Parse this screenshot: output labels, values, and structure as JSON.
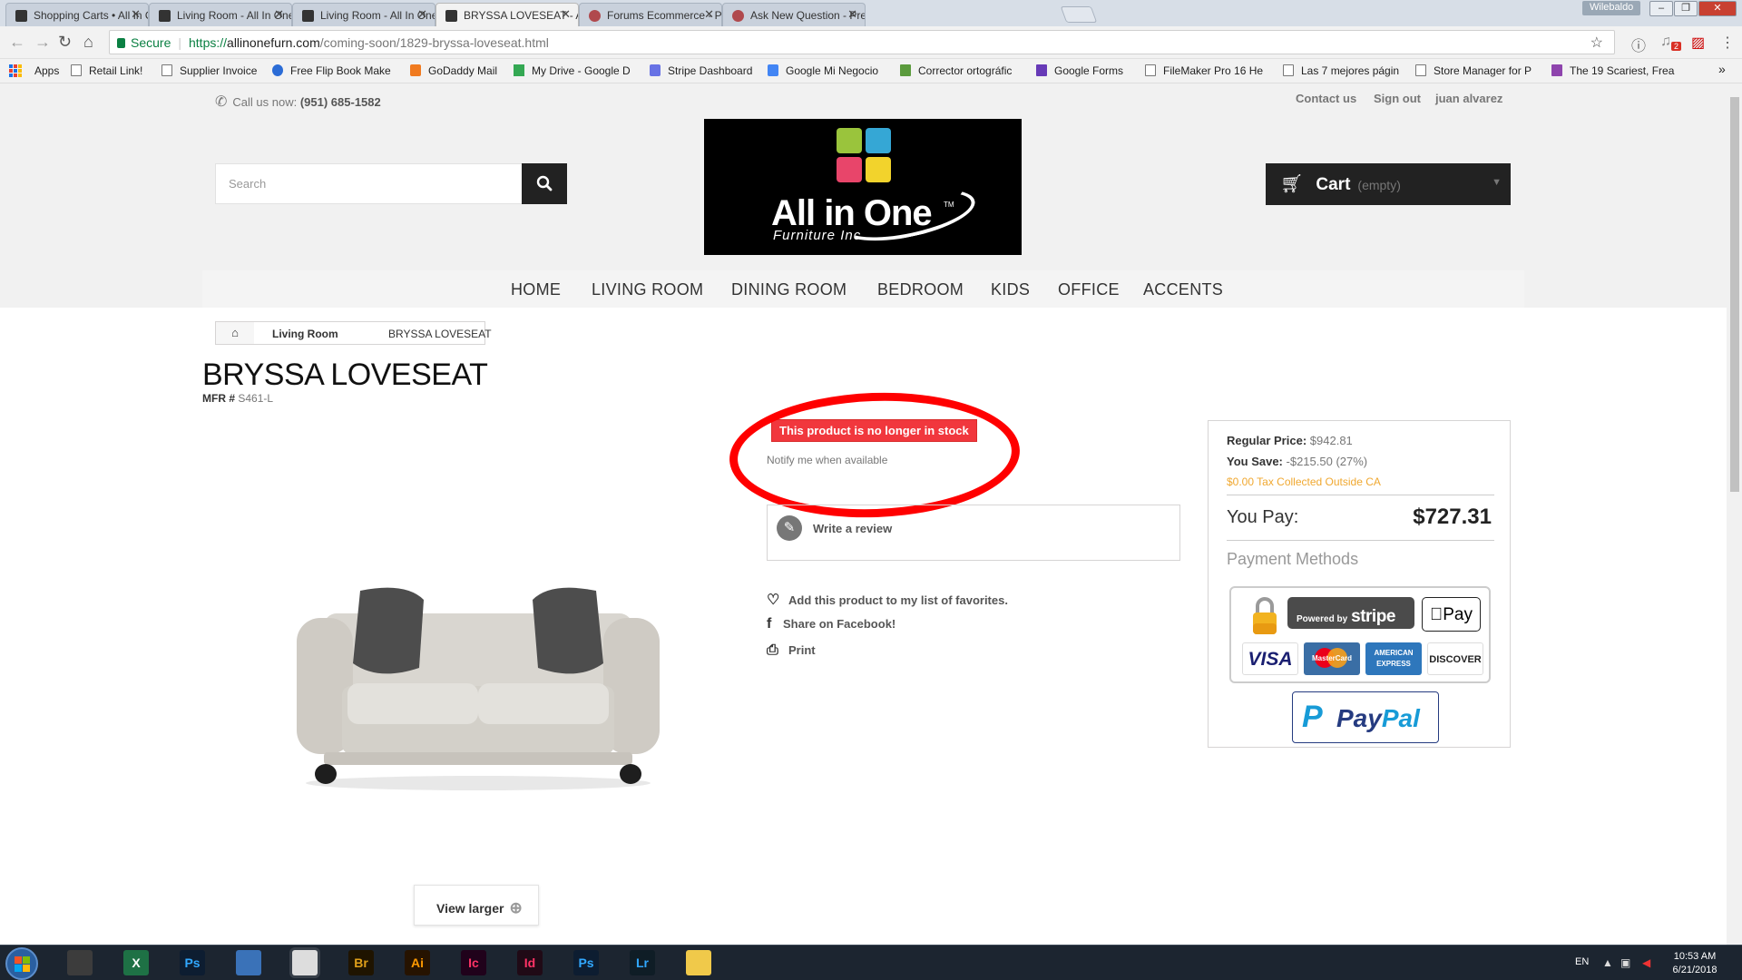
{
  "browser": {
    "tabs": [
      {
        "title": "Shopping Carts • All In O",
        "active": false,
        "icon": "site-icon"
      },
      {
        "title": "Living Room - All In One",
        "active": false,
        "icon": "site-icon"
      },
      {
        "title": "Living Room - All In One",
        "active": false,
        "icon": "site-icon"
      },
      {
        "title": "BRYSSA LOVESEAT - All I",
        "active": true,
        "icon": "site-icon"
      },
      {
        "title": "Forums Ecommerce - Pre",
        "active": false,
        "icon": "forum-icon"
      },
      {
        "title": "Ask New Question - Pres",
        "active": false,
        "icon": "forum-icon"
      }
    ],
    "profile_name": "Wilebaldo",
    "secure_label": "Secure",
    "url": {
      "scheme": "https://",
      "host": "allinonefurn.com",
      "path": "/coming-soon/1829-bryssa-loveseat.html"
    },
    "extension_badge": "2",
    "bookmarks": [
      {
        "label": "Apps"
      },
      {
        "label": "Retail Link!"
      },
      {
        "label": "Supplier Invoice"
      },
      {
        "label": "Free Flip Book Make"
      },
      {
        "label": "GoDaddy Mail"
      },
      {
        "label": "My Drive - Google D"
      },
      {
        "label": "Stripe Dashboard"
      },
      {
        "label": "Google Mi Negocio"
      },
      {
        "label": "Corrector ortográfic"
      },
      {
        "label": "Google Forms"
      },
      {
        "label": "FileMaker Pro 16 He"
      },
      {
        "label": "Las 7 mejores págin"
      },
      {
        "label": "Store Manager for P"
      },
      {
        "label": "The 19 Scariest, Frea"
      }
    ],
    "bookmarks_overflow": "»"
  },
  "header": {
    "call_label": "Call us now:",
    "phone": "(951) 685-1582",
    "top_links": [
      "Contact us",
      "Sign out",
      "juan alvarez"
    ],
    "search_placeholder": "Search",
    "logo": {
      "title": "All in One",
      "subtitle": "Furniture Inc.",
      "tm": "TM"
    },
    "cart": {
      "label": "Cart",
      "status": "(empty)"
    }
  },
  "nav": {
    "items": [
      "HOME",
      "LIVING ROOM",
      "DINING ROOM",
      "BEDROOM",
      "KIDS",
      "OFFICE",
      "ACCENTS"
    ]
  },
  "breadcrumb": {
    "category": "Living Room",
    "current": "BRYSSA LOVESEAT"
  },
  "product": {
    "title": "BRYSSA LOVESEAT",
    "mfr_label": "MFR #",
    "mfr_value": "S461-L",
    "view_larger": "View larger",
    "stock_status": "This product is no longer in stock",
    "notify": "Notify me when available",
    "write_review": "Write a review",
    "actions": [
      {
        "label": "Add this product to my list of favorites.",
        "icon": "heart-icon"
      },
      {
        "label": "Share on Facebook!",
        "icon": "facebook-icon"
      },
      {
        "label": "Print",
        "icon": "print-icon"
      }
    ]
  },
  "pricing": {
    "regular_label": "Regular Price:",
    "regular_value": "$942.81",
    "save_label": "You Save:",
    "save_value": "-$215.50 (27%)",
    "tax_note": "$0.00 Tax Collected Outside CA",
    "pay_label": "You Pay:",
    "pay_value": "$727.31",
    "payment_methods_title": "Payment Methods",
    "stripe_powered": "Powered by",
    "stripe_brand": "stripe",
    "apple_pay": "Pay",
    "cards": [
      "VISA",
      "MasterCard",
      "AMERICAN EXPRESS",
      "DISCOVER"
    ],
    "paypal": {
      "pay": "Pay",
      "pal": "Pal"
    }
  },
  "taskbar": {
    "apps": [
      {
        "label": "",
        "name": "task-manager-icon",
        "color": "#3c3c3c"
      },
      {
        "label": "X",
        "name": "excel-icon",
        "color": "#1e7145"
      },
      {
        "label": "Ps",
        "name": "photoshop-icon",
        "color": "#0d1d31"
      },
      {
        "label": "",
        "name": "windows-app-icon",
        "color": "#3a72b8"
      },
      {
        "label": "",
        "name": "chrome-icon",
        "color": "#dddddd"
      },
      {
        "label": "Br",
        "name": "bridge-icon",
        "color": "#1f1400"
      },
      {
        "label": "Ai",
        "name": "illustrator-icon",
        "color": "#261300"
      },
      {
        "label": "Ic",
        "name": "incopy-icon",
        "color": "#20021b"
      },
      {
        "label": "Id",
        "name": "indesign-icon",
        "color": "#200a16"
      },
      {
        "label": "Ps",
        "name": "photoshop-icon-2",
        "color": "#0d1d31"
      },
      {
        "label": "Lr",
        "name": "lightroom-icon",
        "color": "#0f1d26"
      },
      {
        "label": "",
        "name": "file-explorer-icon",
        "color": "#f0c94a"
      }
    ],
    "lang": "EN",
    "time": "10:53 AM",
    "date": "6/21/2018"
  }
}
